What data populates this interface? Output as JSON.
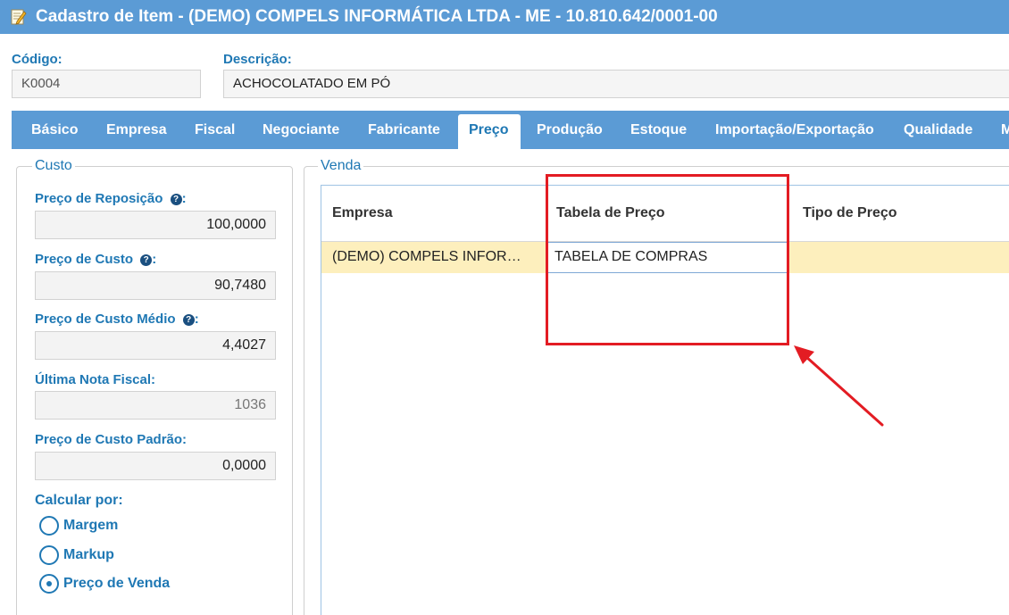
{
  "window": {
    "title": "Cadastro de Item - (DEMO) COMPELS INFORMÁTICA LTDA - ME - 10.810.642/0001-00"
  },
  "header": {
    "codigo_label": "Código:",
    "codigo_value": "K0004",
    "descricao_label": "Descrição:",
    "descricao_value": "ACHOCOLATADO EM PÓ"
  },
  "tabs": [
    "Básico",
    "Empresa",
    "Fiscal",
    "Negociante",
    "Fabricante",
    "Preço",
    "Produção",
    "Estoque",
    "Importação/Exportação",
    "Qualidade",
    "M"
  ],
  "active_tab": "Preço",
  "custo": {
    "legend": "Custo",
    "fields": [
      {
        "label": "Preço de Reposição",
        "help": true,
        "value": "100,0000",
        "readonly": false
      },
      {
        "label": "Preço de Custo",
        "help": true,
        "value": "90,7480",
        "readonly": false
      },
      {
        "label": "Preço de Custo Médio",
        "help": true,
        "value": "4,4027",
        "readonly": false
      },
      {
        "label": "Última Nota Fiscal",
        "help": false,
        "value": "1036",
        "readonly": true
      },
      {
        "label": "Preço de Custo Padrão",
        "help": false,
        "value": "0,0000",
        "readonly": false
      }
    ],
    "colon": ":",
    "help_glyph": "?",
    "calcular_label": "Calcular por:",
    "options": [
      "Margem",
      "Markup",
      "Preço de Venda"
    ],
    "selected_option": "Preço de Venda"
  },
  "venda": {
    "legend": "Venda",
    "columns": [
      "Empresa",
      "Tabela de Preço",
      "Tipo de Preço"
    ],
    "rows": [
      [
        "(DEMO) COMPELS INFOR…",
        "TABELA DE COMPRAS",
        ""
      ]
    ]
  },
  "colors": {
    "accent": "#5b9bd5",
    "label": "#1f78b4",
    "row_highlight": "#fdefbd",
    "annotation": "#e31c23"
  },
  "icons": {
    "title": "edit-form-icon",
    "help": "help-circle-icon"
  }
}
